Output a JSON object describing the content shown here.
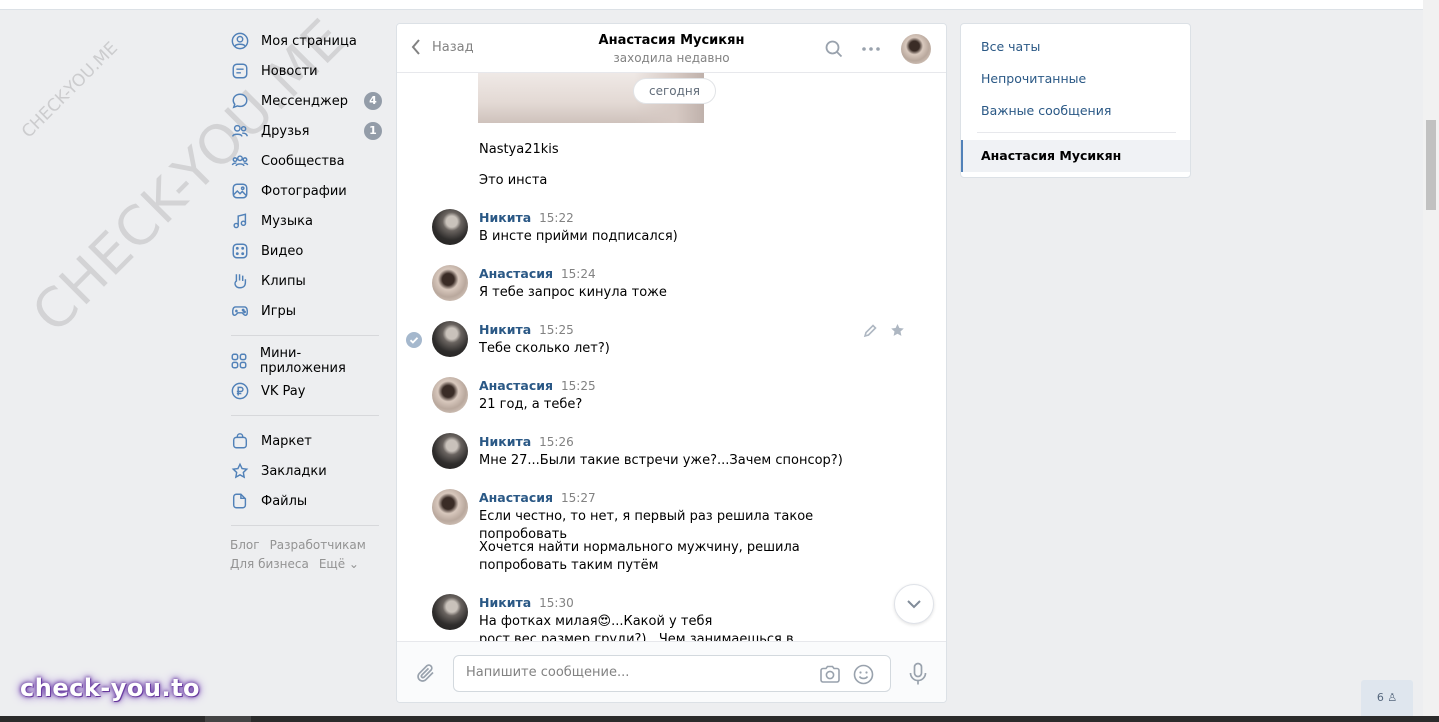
{
  "watermark": {
    "big": "CHECK-YOU.ME",
    "small": "CHECK-YOU.ME",
    "brand": "check-you.to"
  },
  "nav": {
    "items": [
      {
        "label": "Моя страница",
        "icon": "user-circle-icon"
      },
      {
        "label": "Новости",
        "icon": "news-icon"
      },
      {
        "label": "Мессенджер",
        "icon": "message-bubble-icon",
        "badge": "4"
      },
      {
        "label": "Друзья",
        "icon": "friends-icon",
        "badge": "1"
      },
      {
        "label": "Сообщества",
        "icon": "communities-icon"
      },
      {
        "label": "Фотографии",
        "icon": "photo-icon"
      },
      {
        "label": "Музыка",
        "icon": "music-note-icon"
      },
      {
        "label": "Видео",
        "icon": "video-icon"
      },
      {
        "label": "Клипы",
        "icon": "clips-icon"
      },
      {
        "label": "Игры",
        "icon": "gamepad-icon"
      }
    ],
    "group2": [
      {
        "label": "Мини-приложения",
        "icon": "mini-apps-icon"
      },
      {
        "label": "VK Pay",
        "icon": "ruble-icon"
      }
    ],
    "group3": [
      {
        "label": "Маркет",
        "icon": "bag-icon"
      },
      {
        "label": "Закладки",
        "icon": "star-icon"
      },
      {
        "label": "Файлы",
        "icon": "file-icon"
      }
    ],
    "footer": {
      "blog": "Блог",
      "dev": "Разработчикам",
      "business": "Для бизнеса",
      "more": "Ещё ⌄"
    }
  },
  "chat": {
    "back_label": "Назад",
    "peer_name": "Анастасия Мусикян",
    "peer_status": "заходила недавно",
    "date_pill": "сегодня",
    "lines": [
      "Nastya21kis",
      "Это инста"
    ],
    "messages": [
      {
        "author": "Никита",
        "time": "15:22",
        "text": "В инсте прийми подписался)"
      },
      {
        "author": "Анастасия",
        "time": "15:24",
        "text": "Я тебе запрос кинула тоже"
      },
      {
        "author": "Никита",
        "time": "15:25",
        "text": "Тебе сколько лет?)"
      },
      {
        "author": "Анастасия",
        "time": "15:25",
        "text": "21 год, а тебе?"
      },
      {
        "author": "Никита",
        "time": "15:26",
        "text": "Мне 27...Были такие встречи уже?...Зачем спонсор?)"
      },
      {
        "author": "Анастасия",
        "time": "15:27",
        "text": "Если честно, то нет, я первый раз решила такое попробовать",
        "text2": "Хочется найти нормального мужчину, решила попробовать таким путём"
      },
      {
        "author": "Никита",
        "time": "15:30",
        "text": "На фотках милая😍...Какой у тебя рост,вес,размер груди?)...Чем занимаешься в жизни?...Дети есть?"
      }
    ],
    "composer_placeholder": "Напишите сообщение..."
  },
  "right": {
    "all_chats": "Все чаты",
    "unread": "Непрочитанные",
    "important": "Важные сообщения",
    "active_chat": "Анастасия Мусикян"
  },
  "online_count": "6"
}
